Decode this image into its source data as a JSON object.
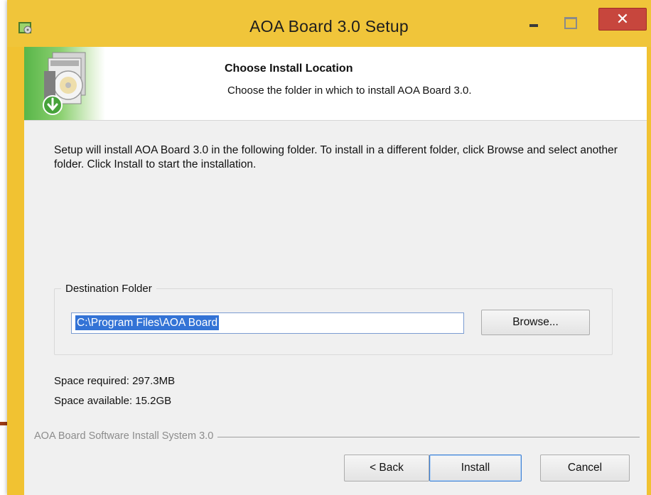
{
  "window": {
    "title": "AOA Board 3.0 Setup",
    "icon": "installer-app-icon",
    "controls": {
      "minimize_icon": "minimize-icon",
      "maximize_icon": "maximize-icon",
      "close_glyph": "✕"
    }
  },
  "header": {
    "title": "Choose Install Location",
    "subtitle": "Choose the folder in which to install AOA Board 3.0.",
    "graphic": "install-disc-icon"
  },
  "body": {
    "description": "Setup will install AOA Board 3.0 in the following folder. To install in a different folder, click Browse and select another folder. Click Install to start the installation."
  },
  "destination": {
    "group_label": "Destination Folder",
    "path_value": "C:\\Program Files\\AOA Board",
    "browse_label": "Browse..."
  },
  "space": {
    "required": "Space required: 297.3MB",
    "available": "Space available: 15.2GB"
  },
  "branding": "AOA Board Software Install System 3.0",
  "footer": {
    "back_label": "< Back",
    "install_label": "Install",
    "cancel_label": "Cancel"
  },
  "colors": {
    "titlebar": "#f0c53a",
    "close_button": "#c7463d",
    "selection": "#3373d6",
    "header_green": "#59b649"
  }
}
